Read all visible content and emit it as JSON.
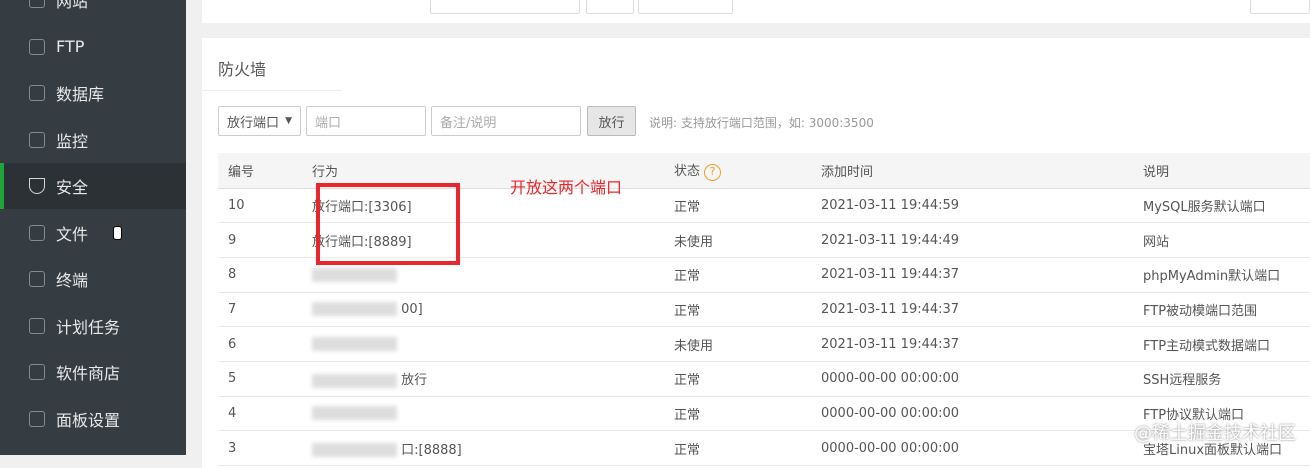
{
  "sidebar": {
    "items": [
      {
        "label": "网站"
      },
      {
        "label": "FTP"
      },
      {
        "label": "数据库"
      },
      {
        "label": "监控"
      },
      {
        "label": "安全",
        "active": true
      },
      {
        "label": "文件"
      },
      {
        "label": "终端"
      },
      {
        "label": "计划任务"
      },
      {
        "label": "软件商店"
      },
      {
        "label": "面板设置"
      }
    ]
  },
  "firewall": {
    "title": "防火墙",
    "select_value": "放行端口",
    "port_placeholder": "端口",
    "remark_placeholder": "备注/说明",
    "submit_label": "放行",
    "hint": "说明: 支持放行端口范围，如: 3000:3500",
    "columns": [
      "编号",
      "行为",
      "状态",
      "添加时间",
      "说明"
    ],
    "rows": [
      {
        "id": "10",
        "action": "放行端口:[3306]",
        "status": "正常",
        "time": "2021-03-11 19:44:59",
        "desc": "MySQL服务默认端口"
      },
      {
        "id": "9",
        "action": "放行端口:[8889]",
        "status": "未使用",
        "time": "2021-03-11 19:44:49",
        "desc": "网站"
      },
      {
        "id": "8",
        "action": "",
        "status": "正常",
        "time": "2021-03-11 19:44:37",
        "desc": "phpMyAdmin默认端口"
      },
      {
        "id": "7",
        "action": "00]",
        "status": "正常",
        "time": "2021-03-11 19:44:37",
        "desc": "FTP被动模端口范围"
      },
      {
        "id": "6",
        "action": "",
        "status": "未使用",
        "time": "2021-03-11 19:44:37",
        "desc": "FTP主动模式数据端口"
      },
      {
        "id": "5",
        "action": "放行",
        "status": "正常",
        "time": "0000-00-00 00:00:00",
        "desc": "SSH远程服务"
      },
      {
        "id": "4",
        "action": "",
        "status": "正常",
        "time": "0000-00-00 00:00:00",
        "desc": "FTP协议默认端口"
      },
      {
        "id": "3",
        "action": "口:[8888]",
        "status": "正常",
        "time": "0000-00-00 00:00:00",
        "desc": "宝塔Linux面板默认端口"
      }
    ]
  },
  "annotation": "开放这两个端口",
  "watermark": "@稀土掘金技术社区"
}
